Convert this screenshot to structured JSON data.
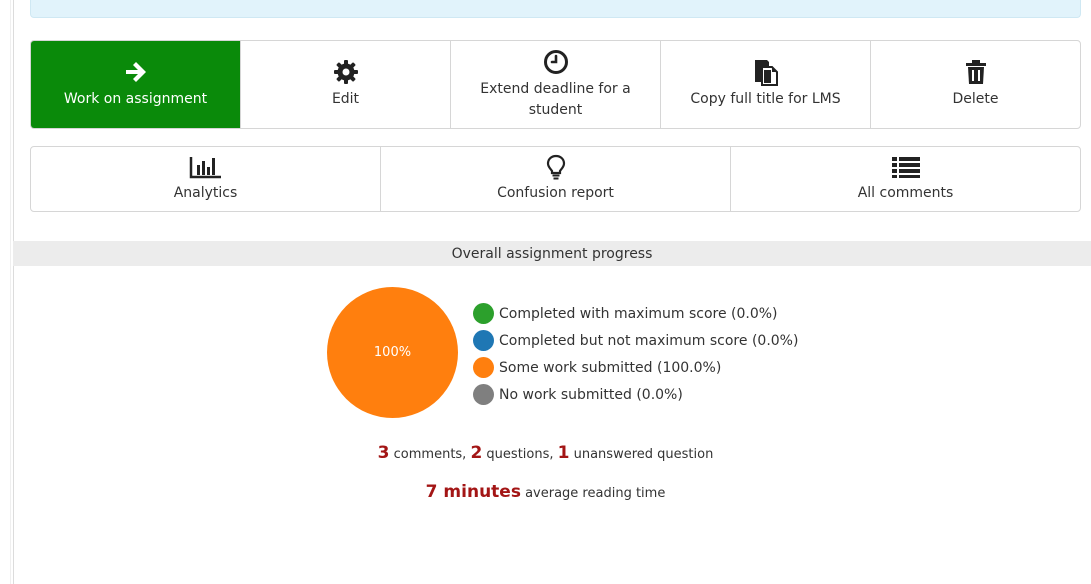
{
  "actions": {
    "work_on_assignment": "Work on assignment",
    "edit": "Edit",
    "extend_deadline": "Extend deadline for a student",
    "copy_title": "Copy full title for LMS",
    "delete": "Delete"
  },
  "reports": {
    "analytics": "Analytics",
    "confusion": "Confusion report",
    "all_comments": "All comments"
  },
  "progress": {
    "heading": "Overall assignment progress",
    "pie_label": "100%",
    "legend": [
      {
        "label": "Completed with maximum score (0.0%)",
        "color": "#2ca02c"
      },
      {
        "label": "Completed but not maximum score (0.0%)",
        "color": "#1f77b4"
      },
      {
        "label": "Some work submitted (100.0%)",
        "color": "#ff7f0e"
      },
      {
        "label": "No work submitted (0.0%)",
        "color": "#7f7f7f"
      }
    ]
  },
  "chart_data": {
    "type": "pie",
    "categories": [
      "Completed with maximum score",
      "Completed but not maximum score",
      "Some work submitted",
      "No work submitted"
    ],
    "values": [
      0.0,
      0.0,
      100.0,
      0.0
    ],
    "colors": [
      "#2ca02c",
      "#1f77b4",
      "#ff7f0e",
      "#7f7f7f"
    ]
  },
  "stats": {
    "comments_count": "3",
    "comments_label": " comments, ",
    "questions_count": "2",
    "questions_label": " questions, ",
    "unanswered_count": "1",
    "unanswered_label": " unanswered question",
    "reading_time": "7 minutes",
    "reading_label": " average reading time"
  },
  "colors": {
    "primary": "#0a8a0a",
    "stat_accent": "#a31515",
    "banner": "#e1f3fb"
  }
}
